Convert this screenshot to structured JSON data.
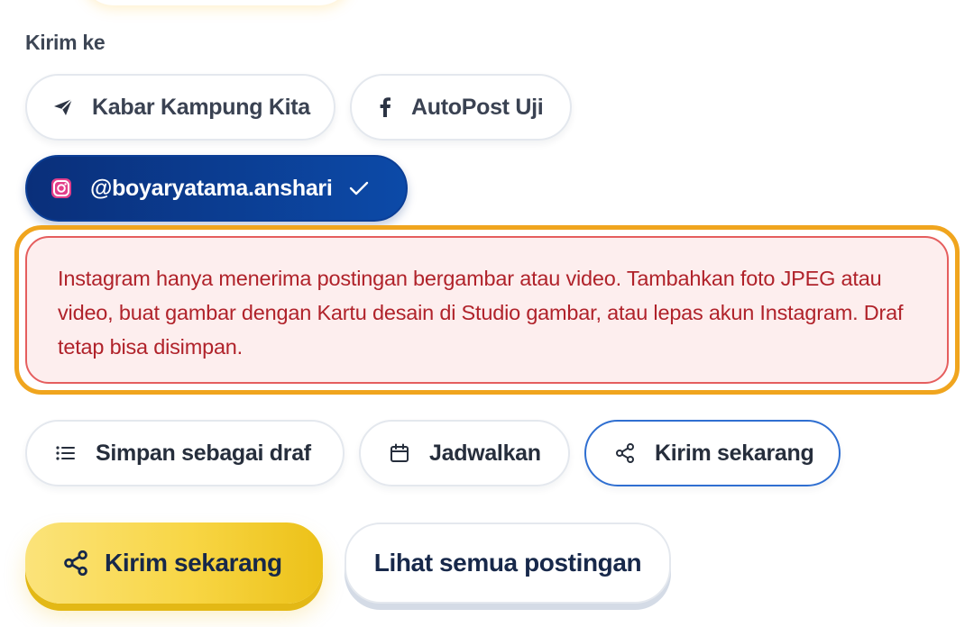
{
  "destinations": {
    "label": "Kirim ke",
    "channels": [
      {
        "name": "Kabar Kampung Kita",
        "icon": "telegram-icon",
        "selected": false
      },
      {
        "name": "AutoPost Uji",
        "icon": "facebook-icon",
        "selected": false
      },
      {
        "name": "@boyaryatama.anshari",
        "icon": "instagram-icon",
        "selected": true
      }
    ]
  },
  "alert": {
    "message": "Instagram hanya menerima postingan bergambar atau video. Tambahkan foto JPEG atau video, buat gambar dengan Kartu desain di Studio gambar, atau lepas akun Instagram. Draf tetap bisa disimpan."
  },
  "actions": {
    "save_draft": "Simpan sebagai draf",
    "schedule": "Jadwalkan",
    "send_now": "Kirim sekarang",
    "selected": "send_now"
  },
  "footer": {
    "primary": "Kirim sekarang",
    "secondary": "Lihat semua postingan"
  },
  "colors": {
    "instagram_chip": "#0c4aa8",
    "alert_text": "#b0222a",
    "alert_border": "#e55e5e",
    "focus_ring": "#f0a51e",
    "primary_button": "#f8d645"
  }
}
